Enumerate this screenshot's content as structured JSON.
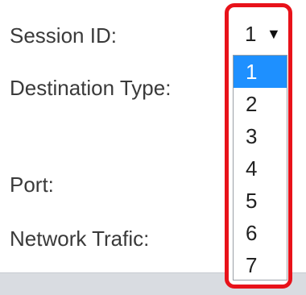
{
  "form": {
    "session_id_label": "Session ID:",
    "destination_type_label": "Destination Type:",
    "port_label": "Port:",
    "network_traffic_label": "Network Trafic:"
  },
  "session_select": {
    "selected_value": "1",
    "arrow_glyph": "▼",
    "options": [
      "1",
      "2",
      "3",
      "4",
      "5",
      "6",
      "7"
    ],
    "highlighted_option": "1"
  },
  "colors": {
    "highlight_frame": "#e8121a",
    "selected_option_bg": "#1e90ff",
    "bottom_bar": "#d9dce1"
  }
}
